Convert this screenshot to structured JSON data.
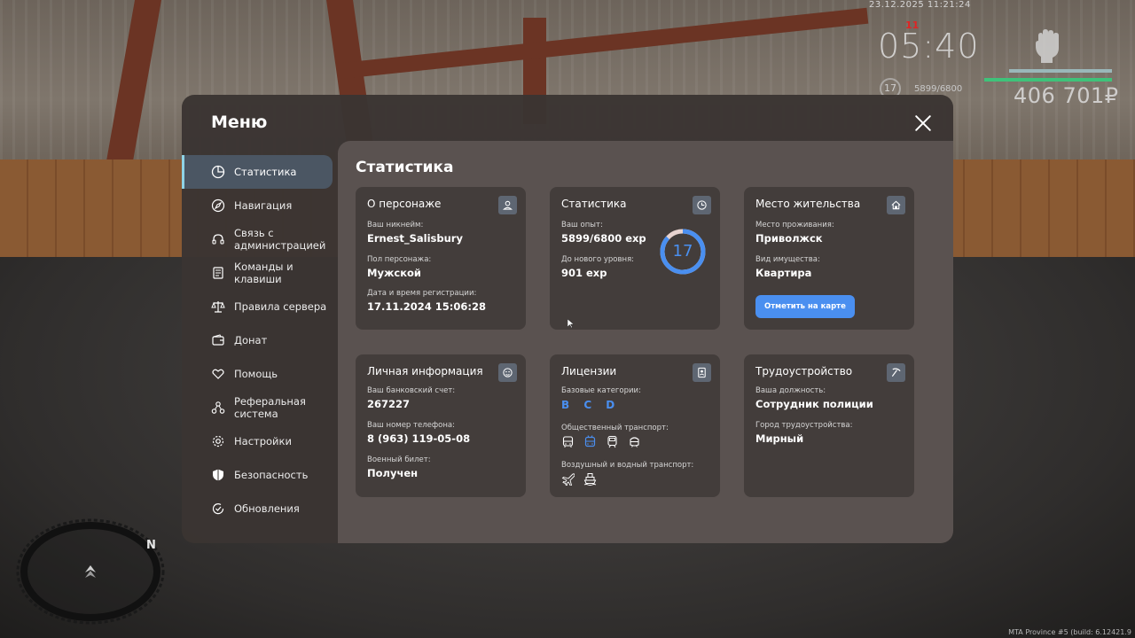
{
  "hud": {
    "datetime": "23.12.2025 11:21:24",
    "wanted": "11",
    "time": "05:40",
    "level": "17",
    "exp": "5899/6800",
    "money": "406 701₽",
    "build": "MTA Province #5 (build: 6.12421.9"
  },
  "menu": {
    "title": "Меню",
    "nav": [
      {
        "label": "Статистика",
        "icon": "pie-chart-icon"
      },
      {
        "label": "Навигация",
        "icon": "compass-icon"
      },
      {
        "label": "Связь с администрацией",
        "icon": "headset-icon"
      },
      {
        "label": "Команды и клавиши",
        "icon": "document-icon"
      },
      {
        "label": "Правила сервера",
        "icon": "scales-icon"
      },
      {
        "label": "Донат",
        "icon": "wallet-icon"
      },
      {
        "label": "Помощь",
        "icon": "heart-hand-icon"
      },
      {
        "label": "Реферальная система",
        "icon": "network-icon"
      },
      {
        "label": "Настройки",
        "icon": "gear-icon"
      },
      {
        "label": "Безопасность",
        "icon": "shield-icon"
      },
      {
        "label": "Обновления",
        "icon": "refresh-check-icon"
      }
    ]
  },
  "stats": {
    "title": "Статистика",
    "character": {
      "title": "О персонаже",
      "nick_label": "Ваш никнейм:",
      "nick": "Ernest_Salisbury",
      "gender_label": "Пол персонажа:",
      "gender": "Мужской",
      "reg_label": "Дата и время регистрации:",
      "reg": "17.11.2024 15:06:28"
    },
    "exp": {
      "title": "Статистика",
      "exp_label": "Ваш опыт:",
      "exp": "5899/6800 exp",
      "next_label": "До нового уровня:",
      "next": "901 exp",
      "level": "17",
      "progress": 0.8675
    },
    "residence": {
      "title": "Место жительства",
      "place_label": "Место проживания:",
      "place": "Приволжск",
      "property_label": "Вид имущества:",
      "property": "Квартира",
      "button": "Отметить на карте"
    },
    "personal": {
      "title": "Личная информация",
      "bank_label": "Ваш банковский счет:",
      "bank": "267227",
      "phone_label": "Ваш номер телефона:",
      "phone": "8 (963) 119-05-08",
      "military_label": "Военный билет:",
      "military": "Получен"
    },
    "licenses": {
      "title": "Лицензии",
      "base_label": "Базовые категории:",
      "base": "B C D",
      "public_label": "Общественный транспорт:",
      "air_label": "Воздушный и водный транспорт:"
    },
    "job": {
      "title": "Трудоустройство",
      "position_label": "Ваша должность:",
      "position": "Сотрудник полиции",
      "city_label": "Город трудоустройства:",
      "city": "Мирный"
    }
  },
  "radar": {
    "north": "N"
  },
  "colors": {
    "accent": "#4a8ff0",
    "active_nav": "#4b5663",
    "highlight": "#8fd3e6"
  }
}
